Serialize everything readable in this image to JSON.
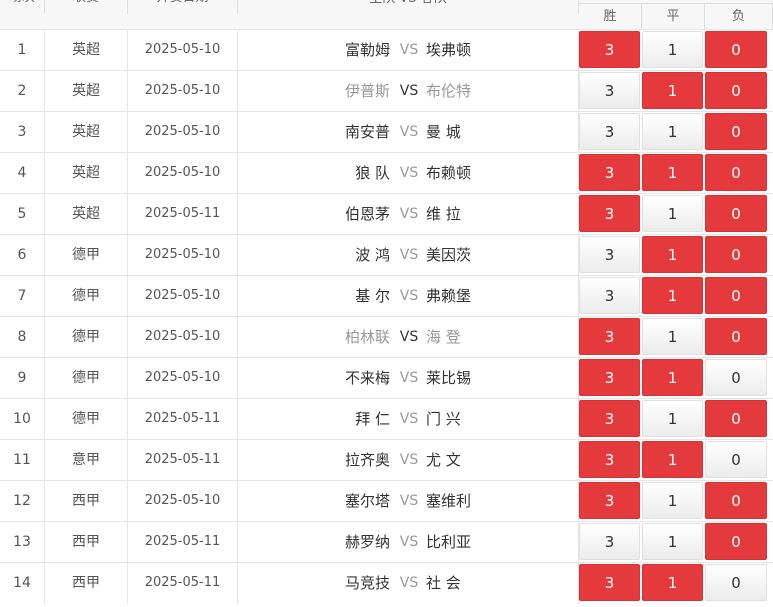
{
  "header": {
    "col_index": "场次",
    "col_league": "联赛",
    "col_date": "开赛日期",
    "col_match": "主队 VS 客队",
    "col_win": "胜",
    "col_draw": "平",
    "col_lose": "负"
  },
  "vs_label": "VS",
  "matches": [
    {
      "no": "1",
      "league": "英超",
      "date": "2025-05-10",
      "home": "富勒姆",
      "away": "埃弗顿",
      "win": "3",
      "draw": "1",
      "lose": "0",
      "sel": [
        true,
        false,
        true
      ],
      "muted": false
    },
    {
      "no": "2",
      "league": "英超",
      "date": "2025-05-10",
      "home": "伊普斯",
      "away": "布伦特",
      "win": "3",
      "draw": "1",
      "lose": "0",
      "sel": [
        false,
        true,
        true
      ],
      "muted": true
    },
    {
      "no": "3",
      "league": "英超",
      "date": "2025-05-10",
      "home": "南安普",
      "away": "曼 城",
      "win": "3",
      "draw": "1",
      "lose": "0",
      "sel": [
        false,
        false,
        true
      ],
      "muted": false
    },
    {
      "no": "4",
      "league": "英超",
      "date": "2025-05-10",
      "home": "狼 队",
      "away": "布赖顿",
      "win": "3",
      "draw": "1",
      "lose": "0",
      "sel": [
        true,
        true,
        true
      ],
      "muted": false
    },
    {
      "no": "5",
      "league": "英超",
      "date": "2025-05-11",
      "home": "伯恩茅",
      "away": "维 拉",
      "win": "3",
      "draw": "1",
      "lose": "0",
      "sel": [
        true,
        false,
        true
      ],
      "muted": false
    },
    {
      "no": "6",
      "league": "德甲",
      "date": "2025-05-10",
      "home": "波 鸿",
      "away": "美因茨",
      "win": "3",
      "draw": "1",
      "lose": "0",
      "sel": [
        false,
        true,
        true
      ],
      "muted": false
    },
    {
      "no": "7",
      "league": "德甲",
      "date": "2025-05-10",
      "home": "基 尔",
      "away": "弗赖堡",
      "win": "3",
      "draw": "1",
      "lose": "0",
      "sel": [
        false,
        true,
        true
      ],
      "muted": false
    },
    {
      "no": "8",
      "league": "德甲",
      "date": "2025-05-10",
      "home": "柏林联",
      "away": "海 登",
      "win": "3",
      "draw": "1",
      "lose": "0",
      "sel": [
        true,
        false,
        true
      ],
      "muted": true
    },
    {
      "no": "9",
      "league": "德甲",
      "date": "2025-05-10",
      "home": "不来梅",
      "away": "莱比锡",
      "win": "3",
      "draw": "1",
      "lose": "0",
      "sel": [
        true,
        true,
        false
      ],
      "muted": false
    },
    {
      "no": "10",
      "league": "德甲",
      "date": "2025-05-11",
      "home": "拜 仁",
      "away": "门 兴",
      "win": "3",
      "draw": "1",
      "lose": "0",
      "sel": [
        true,
        false,
        true
      ],
      "muted": false
    },
    {
      "no": "11",
      "league": "意甲",
      "date": "2025-05-11",
      "home": "拉齐奥",
      "away": "尤 文",
      "win": "3",
      "draw": "1",
      "lose": "0",
      "sel": [
        true,
        true,
        false
      ],
      "muted": false
    },
    {
      "no": "12",
      "league": "西甲",
      "date": "2025-05-10",
      "home": "塞尔塔",
      "away": "塞维利",
      "win": "3",
      "draw": "1",
      "lose": "0",
      "sel": [
        true,
        false,
        true
      ],
      "muted": false
    },
    {
      "no": "13",
      "league": "西甲",
      "date": "2025-05-11",
      "home": "赫罗纳",
      "away": "比利亚",
      "win": "3",
      "draw": "1",
      "lose": "0",
      "sel": [
        false,
        false,
        true
      ],
      "muted": false
    },
    {
      "no": "14",
      "league": "西甲",
      "date": "2025-05-11",
      "home": "马竞技",
      "away": "社 会",
      "win": "3",
      "draw": "1",
      "lose": "0",
      "sel": [
        true,
        true,
        false
      ],
      "muted": false
    }
  ],
  "colors": {
    "selected": "#e43a3d",
    "unselected": "#f2f2f2",
    "muted_text": "#999999"
  }
}
